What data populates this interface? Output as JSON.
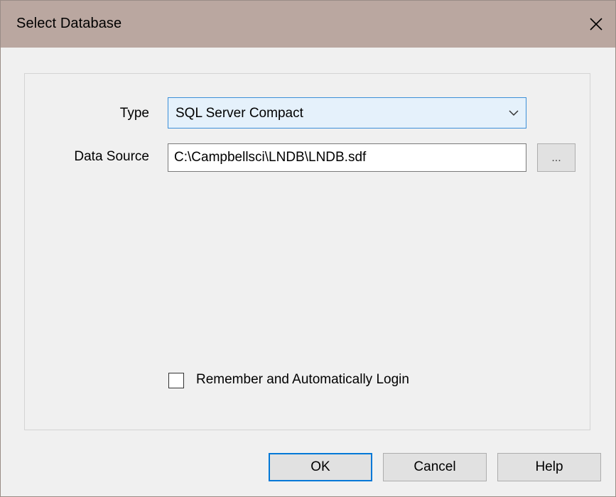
{
  "window": {
    "title": "Select Database",
    "close_icon": "close-icon"
  },
  "form": {
    "type_label": "Type",
    "type_value": "SQL Server Compact",
    "type_icon": "chevron-down-icon",
    "source_label": "Data Source",
    "source_value": "C:\\Campbellsci\\LNDB\\LNDB.sdf",
    "browse_label": "...",
    "remember_label": "Remember and Automatically Login",
    "remember_checked": false
  },
  "buttons": {
    "ok": "OK",
    "cancel": "Cancel",
    "help": "Help"
  },
  "colors": {
    "titlebar": "#baa7a0",
    "accent": "#0078d7",
    "dialog_bg": "#f0f0f0"
  }
}
